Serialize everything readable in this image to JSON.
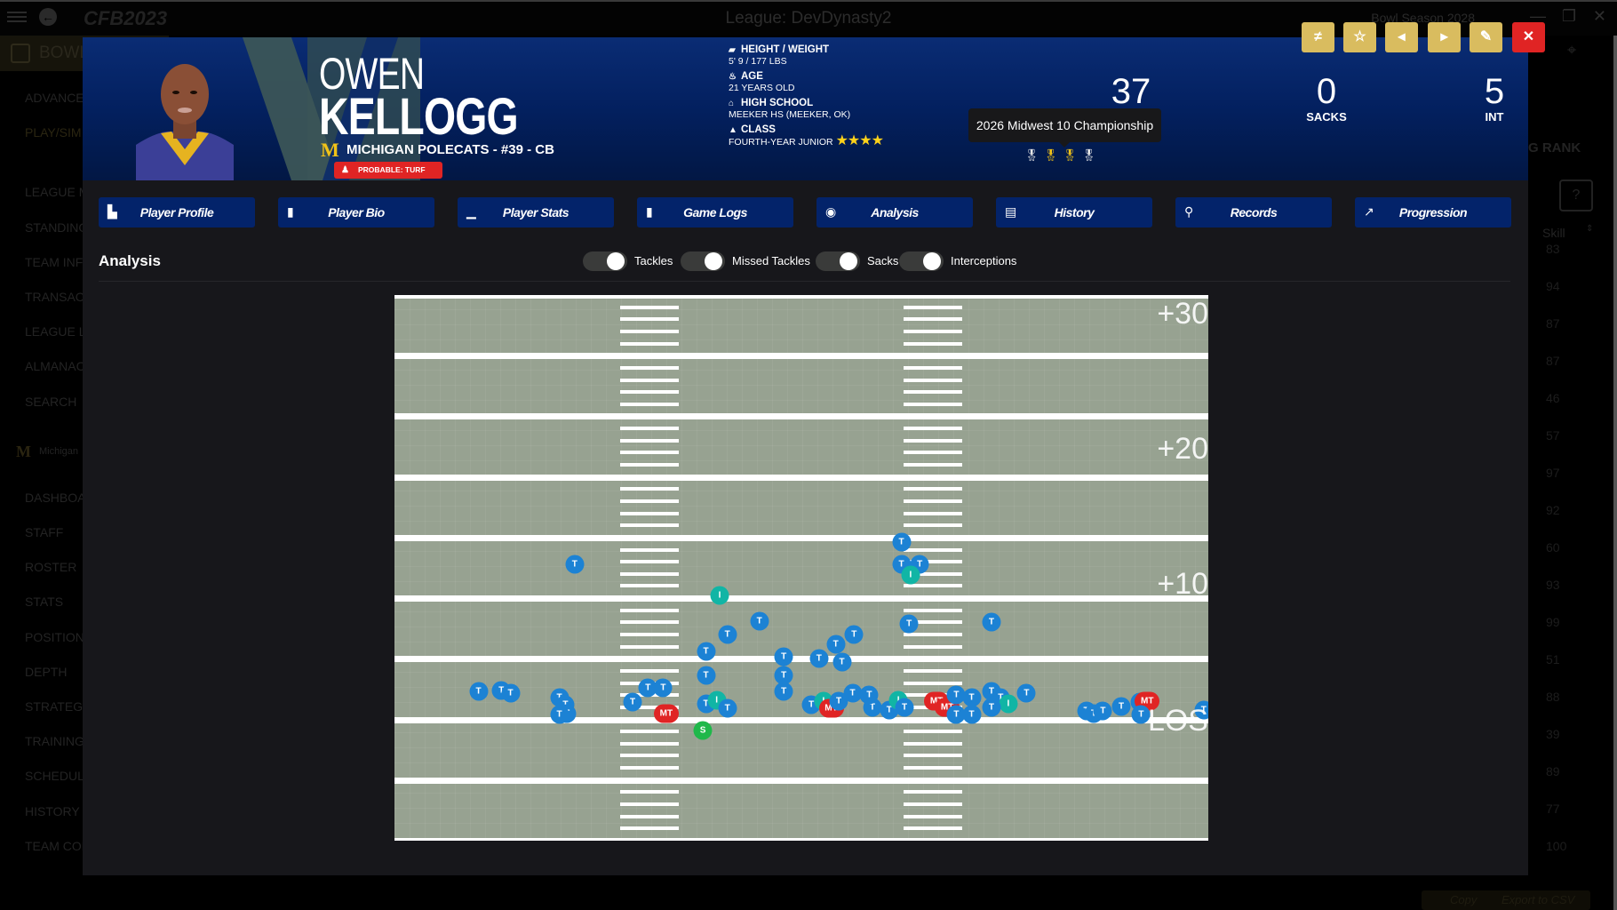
{
  "window": {
    "title": "League: DevDynasty2",
    "season": "Bowl Season 2028",
    "logo": "CFB2023",
    "minimize_icon": "minimize-icon",
    "restore_icon": "restore-icon",
    "close_icon": "close-icon"
  },
  "background_app": {
    "bowl_label": "BOWL",
    "sidebar": [
      "ADVANCE",
      "PLAY/SIM",
      "LEAGUE M",
      "STANDING",
      "TEAM INF",
      "TRANSAC",
      "LEAGUE L",
      "ALMANAC",
      "SEARCH",
      "Michigan",
      "DASHBOA",
      "STAFF",
      "ROSTER",
      "STATS",
      "POSITION",
      "DEPTH",
      "STRATEGY",
      "TRAINING",
      "SCHEDUL",
      "HISTORY",
      "TEAM CON"
    ],
    "rank_header": "G RANK",
    "help_button": "?",
    "skill_header": "Skill",
    "skill_values": [
      "83",
      "94",
      "87",
      "87",
      "46",
      "57",
      "97",
      "92",
      "60",
      "93",
      "99",
      "51",
      "88",
      "39",
      "89",
      "77",
      "100"
    ],
    "copy_label": "Copy",
    "export_label": "Export to CSV"
  },
  "player": {
    "first_name": "OWEN",
    "last_name": "KELLOGG",
    "team_logo": "M",
    "team_line": "MICHIGAN POLECATS - #39 - CB",
    "injury": "PROBABLE: TURF TOE",
    "height_weight_label": "HEIGHT / WEIGHT",
    "height_weight": "5' 9 / 177 LBS",
    "age_label": "AGE",
    "age": "21 YEARS OLD",
    "high_school_label": "HIGH SCHOOL",
    "high_school": "MEEKER HS (MEEKER, OK)",
    "class_label": "CLASS",
    "class": "FOURTH-YEAR JUNIOR",
    "star_rating": 4,
    "stars": "★★★★"
  },
  "stats": [
    {
      "value": "37",
      "label": ""
    },
    {
      "value": "0",
      "label": "SACKS"
    },
    {
      "value": "5",
      "label": "INT"
    }
  ],
  "tooltip": "2026 Midwest 10 Championship",
  "awards": [
    {
      "icon": "award-icon",
      "color": "#e6e6e6"
    },
    {
      "icon": "award-icon",
      "color": "#f2c318"
    },
    {
      "icon": "award-icon",
      "color": "#f2c318"
    },
    {
      "icon": "award-icon",
      "color": "#e6e6e6"
    }
  ],
  "actions": [
    {
      "name": "compare-button",
      "glyph": "≠"
    },
    {
      "name": "favorite-button",
      "glyph": "☆"
    },
    {
      "name": "previous-button",
      "glyph": "◂"
    },
    {
      "name": "next-button",
      "glyph": "▸"
    },
    {
      "name": "edit-button",
      "glyph": "✎"
    },
    {
      "name": "close-button",
      "glyph": "✕"
    }
  ],
  "tabs": [
    {
      "label": "Player Profile",
      "icon": "▙"
    },
    {
      "label": "Player Bio",
      "icon": "▮"
    },
    {
      "label": "Player Stats",
      "icon": "▁"
    },
    {
      "label": "Game Logs",
      "icon": "▮"
    },
    {
      "label": "Analysis",
      "icon": "◉"
    },
    {
      "label": "History",
      "icon": "▤"
    },
    {
      "label": "Records",
      "icon": "⚲"
    },
    {
      "label": "Progression",
      "icon": "↗"
    }
  ],
  "analysis": {
    "title": "Analysis",
    "toggles": [
      {
        "label": "Tackles",
        "on": true
      },
      {
        "label": "Missed Tackles",
        "on": true
      },
      {
        "label": "Sacks",
        "on": true
      },
      {
        "label": "Interceptions",
        "on": true
      }
    ]
  },
  "field": {
    "yard_labels": [
      "+30",
      "+20",
      "+10",
      "LOS"
    ],
    "colors": {
      "T": "#1c82d4",
      "I": "#11b5a5",
      "S": "#1fb84a",
      "MT": "#e02424"
    },
    "markers_note": "markers given in yards: x = lateral yards from left sideline (0-53.3), y = yards past LOS (positive downfield)",
    "markers": [
      {
        "t": "T",
        "x": 11.8,
        "y": 12.8
      },
      {
        "t": "I",
        "x": 21.3,
        "y": 10.2
      },
      {
        "t": "T",
        "x": 33.2,
        "y": 14.6
      },
      {
        "t": "T",
        "x": 33.2,
        "y": 12.8
      },
      {
        "t": "T",
        "x": 34.4,
        "y": 12.8
      },
      {
        "t": "I",
        "x": 33.8,
        "y": 11.9
      },
      {
        "t": "T",
        "x": 23.9,
        "y": 8.1
      },
      {
        "t": "T",
        "x": 21.8,
        "y": 7.0
      },
      {
        "t": "T",
        "x": 20.4,
        "y": 5.6
      },
      {
        "t": "T",
        "x": 25.5,
        "y": 5.2
      },
      {
        "t": "T",
        "x": 20.4,
        "y": 3.6
      },
      {
        "t": "T",
        "x": 27.8,
        "y": 5.0
      },
      {
        "t": "T",
        "x": 28.9,
        "y": 6.2
      },
      {
        "t": "T",
        "x": 30.1,
        "y": 7.0
      },
      {
        "t": "T",
        "x": 29.3,
        "y": 4.7
      },
      {
        "t": "T",
        "x": 33.7,
        "y": 7.9
      },
      {
        "t": "T",
        "x": 39.1,
        "y": 8.0
      },
      {
        "t": "T",
        "x": 5.5,
        "y": 2.3
      },
      {
        "t": "T",
        "x": 7.0,
        "y": 2.4
      },
      {
        "t": "T",
        "x": 7.6,
        "y": 2.2
      },
      {
        "t": "T",
        "x": 10.8,
        "y": 1.8
      },
      {
        "t": "T",
        "x": 11.2,
        "y": 1.2
      },
      {
        "t": "T",
        "x": 11.3,
        "y": 0.5
      },
      {
        "t": "T",
        "x": 15.6,
        "y": 1.4
      },
      {
        "t": "T",
        "x": 16.6,
        "y": 2.6
      },
      {
        "t": "T",
        "x": 17.6,
        "y": 2.6
      },
      {
        "t": "T",
        "x": 10.8,
        "y": 0.4
      },
      {
        "t": "MT",
        "x": 17.8,
        "y": 0.5
      },
      {
        "t": "T",
        "x": 20.4,
        "y": 1.3
      },
      {
        "t": "I",
        "x": 21.1,
        "y": 1.6
      },
      {
        "t": "T",
        "x": 21.8,
        "y": 0.9
      },
      {
        "t": "T",
        "x": 25.5,
        "y": 2.3
      },
      {
        "t": "T",
        "x": 25.5,
        "y": 3.6
      },
      {
        "t": "T",
        "x": 27.3,
        "y": 1.2
      },
      {
        "t": "I",
        "x": 28.1,
        "y": 1.5
      },
      {
        "t": "MT",
        "x": 28.6,
        "y": 0.9
      },
      {
        "t": "T",
        "x": 29.1,
        "y": 1.5
      },
      {
        "t": "T",
        "x": 30.0,
        "y": 2.2
      },
      {
        "t": "T",
        "x": 31.3,
        "y": 1.0
      },
      {
        "t": "T",
        "x": 32.4,
        "y": 0.8
      },
      {
        "t": "T",
        "x": 31.1,
        "y": 2.0
      },
      {
        "t": "I",
        "x": 33.0,
        "y": 1.6
      },
      {
        "t": "T",
        "x": 33.4,
        "y": 1.0
      },
      {
        "t": "MT",
        "x": 35.5,
        "y": 1.5
      },
      {
        "t": "MT",
        "x": 36.2,
        "y": 1.0
      },
      {
        "t": "T",
        "x": 36.8,
        "y": 2.0
      },
      {
        "t": "T",
        "x": 37.8,
        "y": 1.8
      },
      {
        "t": "T",
        "x": 36.8,
        "y": 0.4
      },
      {
        "t": "T",
        "x": 37.8,
        "y": 0.4
      },
      {
        "t": "T",
        "x": 39.1,
        "y": 2.3
      },
      {
        "t": "T",
        "x": 39.7,
        "y": 1.8
      },
      {
        "t": "I",
        "x": 40.2,
        "y": 1.3
      },
      {
        "t": "T",
        "x": 39.1,
        "y": 1.0
      },
      {
        "t": "T",
        "x": 41.4,
        "y": 2.2
      },
      {
        "t": "T",
        "x": 45.3,
        "y": 0.7
      },
      {
        "t": "T",
        "x": 45.8,
        "y": 0.5
      },
      {
        "t": "T",
        "x": 46.4,
        "y": 0.7
      },
      {
        "t": "T",
        "x": 47.6,
        "y": 1.1
      },
      {
        "t": "T",
        "x": 48.8,
        "y": 1.4
      },
      {
        "t": "MT",
        "x": 49.3,
        "y": 1.5
      },
      {
        "t": "T",
        "x": 48.9,
        "y": 0.4
      },
      {
        "t": "T",
        "x": 53.0,
        "y": 0.8
      },
      {
        "t": "S",
        "x": 20.2,
        "y": -0.9
      }
    ]
  }
}
